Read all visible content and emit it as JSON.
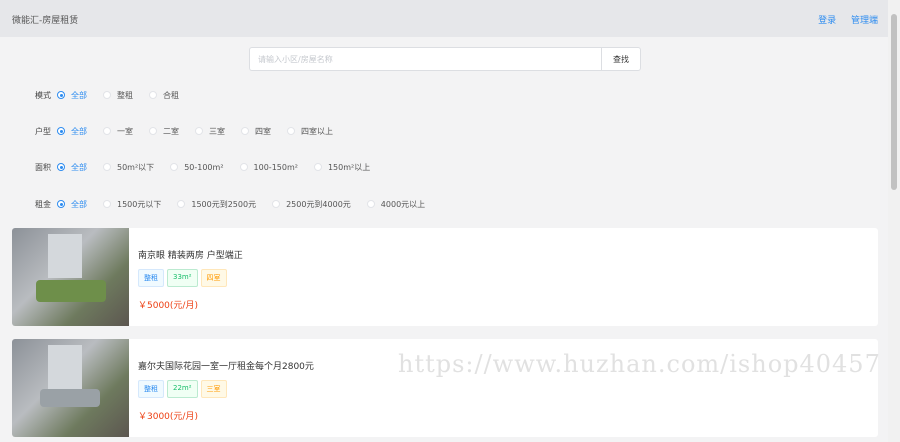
{
  "header": {
    "brand": "微能汇-房屋租赁",
    "login": "登录",
    "admin": "管理端"
  },
  "search": {
    "placeholder": "请输入小区/房屋名称",
    "button": "查找"
  },
  "filters": [
    {
      "label": "模式",
      "options": [
        "全部",
        "整租",
        "合租"
      ],
      "selected": 0
    },
    {
      "label": "户型",
      "options": [
        "全部",
        "一室",
        "二室",
        "三室",
        "四室",
        "四室以上"
      ],
      "selected": 0
    },
    {
      "label": "面积",
      "options": [
        "全部",
        "50m²以下",
        "50-100m²",
        "100-150m²",
        "150m²以上"
      ],
      "selected": 0
    },
    {
      "label": "租金",
      "options": [
        "全部",
        "1500元以下",
        "1500元到2500元",
        "2500元到4000元",
        "4000元以上"
      ],
      "selected": 0
    }
  ],
  "listings": [
    {
      "title": "南京眼 精装两房 户型端正",
      "tags": [
        "整租",
        "33m²",
        "四室"
      ],
      "price": "￥5000(元/月)"
    },
    {
      "title": "嘉尔夫国际花园一室一厅租金每个月2800元",
      "tags": [
        "整租",
        "22m²",
        "三室"
      ],
      "price": "￥3000(元/月)"
    }
  ],
  "watermark": "https://www.huzhan.com/ishop40457"
}
